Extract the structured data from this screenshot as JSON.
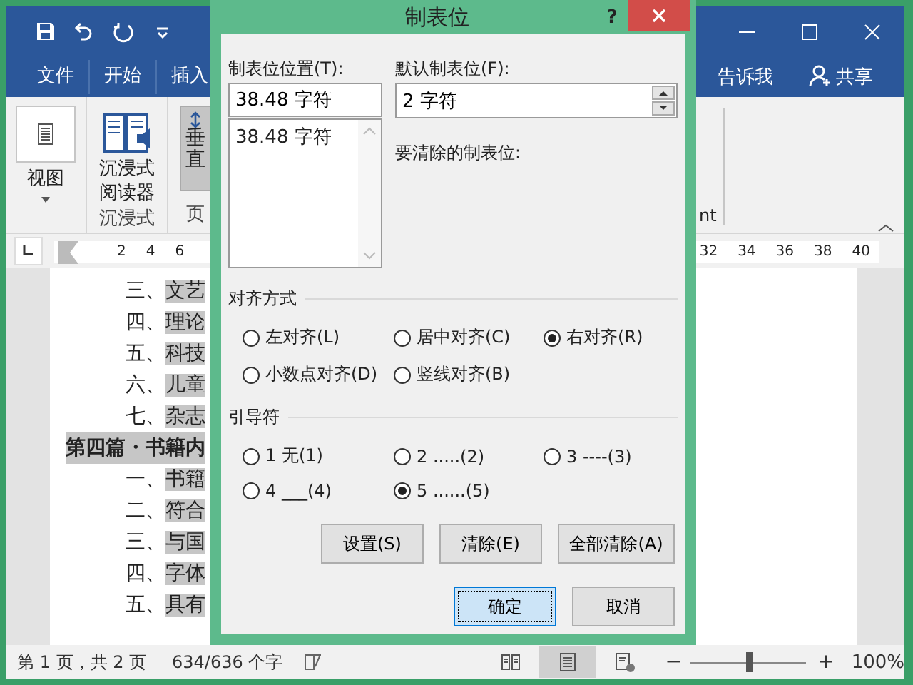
{
  "word_window": {
    "tabs": [
      {
        "label": "文件"
      },
      {
        "label": "开始"
      },
      {
        "label": "插入"
      }
    ],
    "tell_me": "告诉我",
    "share": "共享",
    "ribbon": {
      "view_button": "视图",
      "reader_button": "沉浸式阅读器",
      "reader_group": "沉浸式",
      "vertical_button": "垂直",
      "page_group": "页",
      "cut_group": "nt"
    },
    "ruler": {
      "left_ticks": [
        "2",
        "4",
        "6"
      ],
      "right_ticks": [
        "32",
        "34",
        "36",
        "38",
        "40"
      ]
    },
    "document": {
      "lines": [
        {
          "kind": "item",
          "number": "三、",
          "text": "文艺"
        },
        {
          "kind": "item",
          "number": "四、",
          "text": "理论"
        },
        {
          "kind": "item",
          "number": "五、",
          "text": "科技"
        },
        {
          "kind": "item",
          "number": "六、",
          "text": "儿童"
        },
        {
          "kind": "item",
          "number": "七、",
          "text": "杂志"
        },
        {
          "kind": "heading",
          "text": "第四篇・书籍内"
        },
        {
          "kind": "item",
          "number": "一、",
          "text": "书籍"
        },
        {
          "kind": "item",
          "number": "二、",
          "text": "符合"
        },
        {
          "kind": "item",
          "number": "三、",
          "text": "与国"
        },
        {
          "kind": "item",
          "number": "四、",
          "text": "字体"
        },
        {
          "kind": "item",
          "number": "五、",
          "text": "具有"
        }
      ]
    },
    "status_bar": {
      "page": "第 1 页，共 2 页",
      "words": "634/636 个字",
      "views": [
        {
          "kind": "read",
          "selected": false
        },
        {
          "kind": "print",
          "selected": true
        },
        {
          "kind": "web",
          "selected": false
        }
      ],
      "zoom": {
        "minus": "−",
        "plus": "+",
        "level": 0.5,
        "label": "100%"
      }
    }
  },
  "dialog": {
    "title": "制表位",
    "help": "?",
    "tab_position": {
      "label": "制表位位置(T):",
      "value": "38.48 字符"
    },
    "tab_list": [
      "38.48 字符"
    ],
    "default_tab": {
      "label": "默认制表位(F):",
      "value": "2 字符"
    },
    "clear_label": "要清除的制表位:",
    "alignment": {
      "title": "对齐方式",
      "options": [
        {
          "label": "左对齐(L)",
          "selected": false
        },
        {
          "label": "居中对齐(C)",
          "selected": false
        },
        {
          "label": "右对齐(R)",
          "selected": true
        },
        {
          "label": "小数点对齐(D)",
          "selected": false
        },
        {
          "label": "竖线对齐(B)",
          "selected": false
        }
      ]
    },
    "leader": {
      "title": "引导符",
      "options": [
        {
          "label": "1 无(1)",
          "selected": false
        },
        {
          "label": "2 .....(2)",
          "selected": false
        },
        {
          "label": "3 ----(3)",
          "selected": false
        },
        {
          "label": "4 ___(4)",
          "selected": false
        },
        {
          "label": "5 ......(5)",
          "selected": true
        }
      ]
    },
    "action_buttons": [
      {
        "label": "设置(S)"
      },
      {
        "label": "清除(E)"
      },
      {
        "label": "全部清除(A)"
      }
    ],
    "footer_buttons": [
      {
        "label": "确定",
        "default": true
      },
      {
        "label": "取消",
        "default": false
      }
    ]
  }
}
